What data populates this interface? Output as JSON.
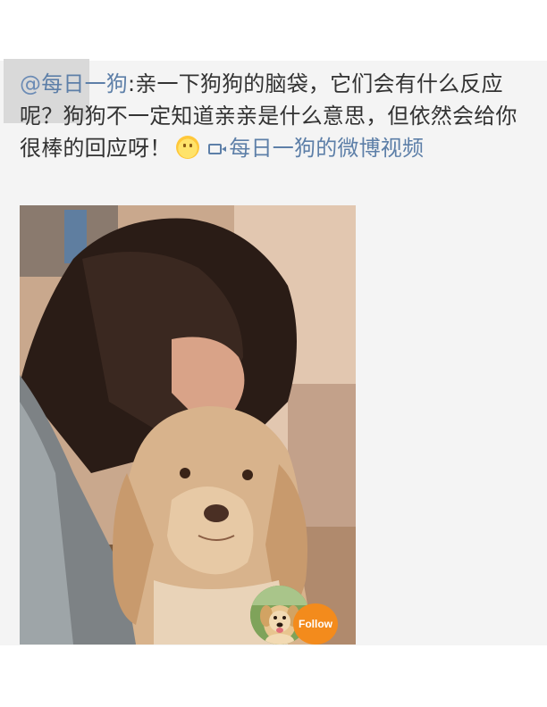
{
  "post": {
    "mention_at": "@",
    "mention_name": "每日一狗",
    "text_separator": ":",
    "text": "亲一下狗狗的脑袋，它们会有什么反应呢？狗狗不一定知道亲亲是什么意思，但依然会给你很棒的回应呀！",
    "emoji_icon": "smiley-sun-icon",
    "video_link_icon": "video-camera-icon",
    "video_link_text": "每日一狗的微博视频"
  },
  "video": {
    "thumbnail_description_icon": "dog-kiss-video-thumbnail"
  },
  "follow": {
    "avatar_icon": "golden-retriever-puppy-avatar",
    "button_label": "Follow"
  },
  "colors": {
    "link": "#5d7fa8",
    "text": "#333333",
    "follow_button": "#f38b1c",
    "background": "#f4f4f4"
  }
}
